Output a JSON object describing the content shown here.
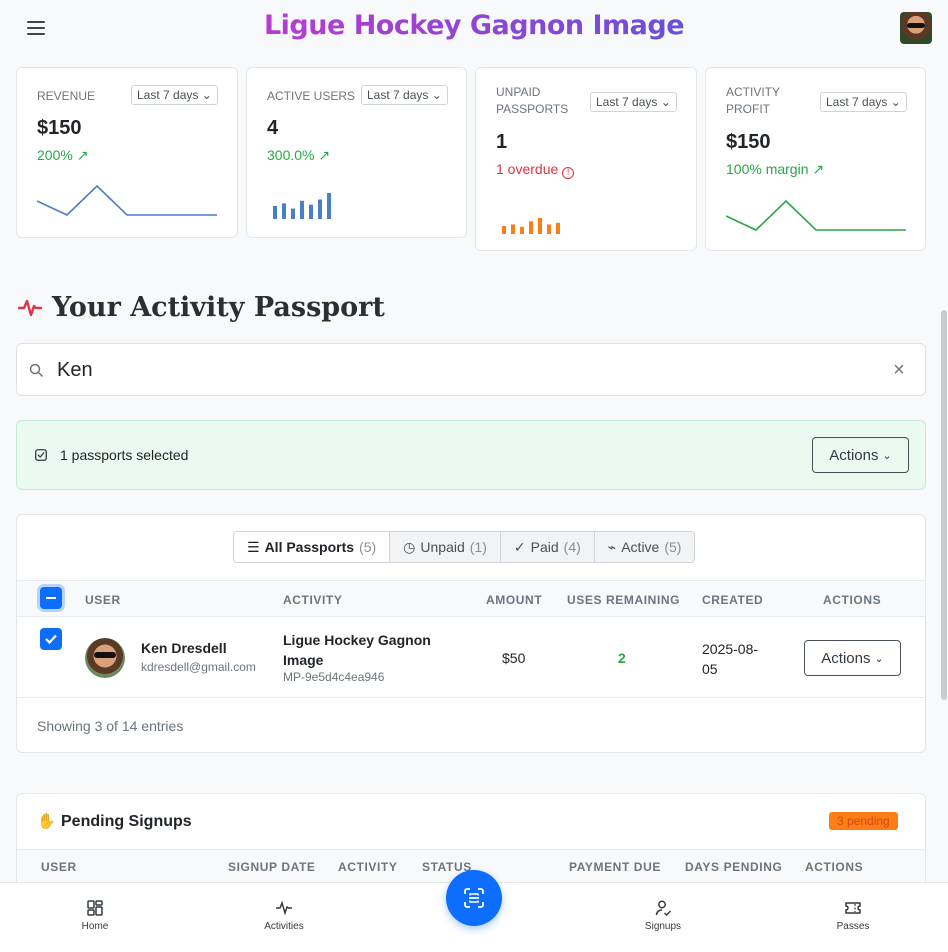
{
  "header": {
    "brand": "Ligue Hockey Gagnon Image"
  },
  "stats": [
    {
      "label": "REVENUE",
      "range": "Last 7 days",
      "value": "$150",
      "sub": "200%",
      "trend": [
        0.5,
        0.1,
        1.0,
        0.0,
        0.0,
        0.0,
        0.0
      ]
    },
    {
      "label": "ACTIVE USERS",
      "range": "Last 7 days",
      "value": "4",
      "sub": "300.0%",
      "bars": [
        0.5,
        0.6,
        0.4,
        0.7,
        0.55,
        0.75,
        1.0
      ]
    },
    {
      "label": "UNPAID PASSPORTS",
      "range": "Last 7 days",
      "value": "1",
      "sub": "1 overdue",
      "bars": [
        0.5,
        0.6,
        0.45,
        0.8,
        1.0,
        0.6,
        0.7
      ]
    },
    {
      "label": "ACTIVITY PROFIT",
      "range": "Last 7 days",
      "value": "$150",
      "sub": "100% margin",
      "trend": [
        0.5,
        0.1,
        1.0,
        0.0,
        0.0,
        0.0,
        0.0
      ]
    }
  ],
  "section": {
    "title": "Your Activity Passport"
  },
  "search": {
    "value": "Ken"
  },
  "selection": {
    "text": "1 passports selected",
    "actions": "Actions"
  },
  "tabs": [
    {
      "label": "All Passports",
      "count": "(5)"
    },
    {
      "label": "Unpaid",
      "count": "(1)"
    },
    {
      "label": "Paid",
      "count": "(4)"
    },
    {
      "label": "Active",
      "count": "(5)"
    }
  ],
  "table": {
    "headers": [
      "USER",
      "ACTIVITY",
      "AMOUNT",
      "USES REMAINING",
      "CREATED",
      "ACTIONS"
    ],
    "row": {
      "name": "Ken Dresdell",
      "email": "kdresdell@gmail.com",
      "activity": "Ligue Hockey Gagnon Image",
      "code": "MP-9e5d4c4ea946",
      "amount": "$50",
      "uses": "2",
      "created": "2025-08-05",
      "action": "Actions"
    },
    "footer": "Showing 3 of 14 entries"
  },
  "pending": {
    "title": "Pending Signups",
    "badge": "3 pending",
    "headers": [
      "USER",
      "SIGNUP DATE",
      "ACTIVITY",
      "STATUS",
      "PAYMENT DUE",
      "DAYS PENDING",
      "ACTIONS"
    ]
  },
  "nav": [
    {
      "label": "Home",
      "icon": "dashboard-icon"
    },
    {
      "label": "Activities",
      "icon": "pulse-icon"
    },
    {
      "label": "Signups",
      "icon": "user-check-icon"
    },
    {
      "label": "Passes",
      "icon": "ticket-icon"
    }
  ],
  "colors": {
    "primary": "#0d6efd",
    "success": "#28a745",
    "danger": "#dc3545",
    "warning": "#fd7e14",
    "chart_blue": "#4a7fc1"
  }
}
